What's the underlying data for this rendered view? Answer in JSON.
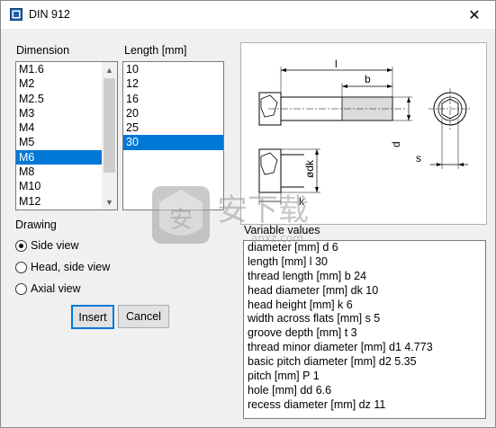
{
  "window": {
    "title": "DIN 912",
    "close_glyph": "✕"
  },
  "dimension": {
    "label": "Dimension",
    "items": [
      "M1.6",
      "M2",
      "M2.5",
      "M3",
      "M4",
      "M5",
      "M6",
      "M8",
      "M10",
      "M12"
    ],
    "selected": "M6"
  },
  "length": {
    "label": "Length [mm]",
    "items": [
      "10",
      "12",
      "16",
      "20",
      "25",
      "30"
    ],
    "selected": "30"
  },
  "drawing": {
    "label": "Drawing",
    "options": [
      "Side view",
      "Head, side view",
      "Axial view"
    ],
    "selected": "Side view"
  },
  "buttons": {
    "insert": "Insert",
    "cancel": "Cancel"
  },
  "diagram": {
    "labels": {
      "l": "l",
      "b": "b",
      "d": "d",
      "dk": "ødk",
      "k": "k",
      "s": "s"
    }
  },
  "variables": {
    "label": "Variable values",
    "lines": [
      "diameter [mm] d 6",
      "length [mm] l 30",
      "thread length [mm] b 24",
      "head diameter [mm] dk 10",
      "head height [mm] k 6",
      "width across flats [mm] s 5",
      "groove depth [mm] t 3",
      "thread minor diameter [mm] d1 4.773",
      "basic pitch diameter [mm] d2 5.35",
      "pitch [mm] P 1",
      "hole [mm] dd 6.6",
      "recess diameter [mm] dz 11"
    ]
  },
  "watermark": {
    "glyph": "安",
    "text": "安下载",
    "domain": "anxz.com"
  },
  "colors": {
    "selection": "#0078d7",
    "window_bg": "#f0f0f0",
    "accent_border": "#0078d7"
  },
  "icons": {
    "app": "din-app-icon",
    "close": "close-icon"
  }
}
